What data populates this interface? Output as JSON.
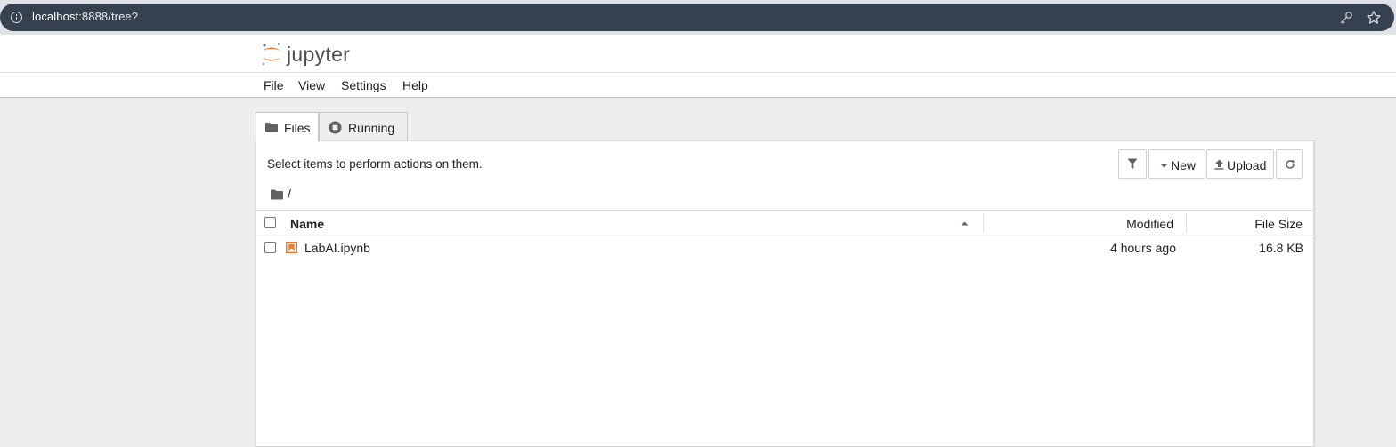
{
  "browser": {
    "url_host": "localhost",
    "url_rest": ":8888/tree?",
    "icons": [
      "info-icon",
      "key-icon",
      "star-icon"
    ]
  },
  "app": {
    "logo_text": "jupyter",
    "menu": [
      "File",
      "View",
      "Settings",
      "Help"
    ]
  },
  "tabs": [
    {
      "label": "Files",
      "icon": "folder-icon",
      "selected": true
    },
    {
      "label": "Running",
      "icon": "stop-circle-icon",
      "selected": false
    }
  ],
  "toolbar": {
    "instructions": "Select items to perform actions on them.",
    "new_label": "New",
    "upload_label": "Upload",
    "icons": [
      "filter-icon",
      "caret-down-icon",
      "upload-icon",
      "refresh-icon"
    ]
  },
  "breadcrumb": {
    "separator": "/"
  },
  "listing": {
    "columns": {
      "name": "Name",
      "modified": "Modified",
      "size": "File Size"
    },
    "sort": "name-ascending",
    "rows": [
      {
        "name": "LabAI.ipynb",
        "modified": "4 hours ago",
        "size": "16.8 KB",
        "icon": "notebook-icon"
      }
    ]
  },
  "colors": {
    "accent": "#f37726",
    "browser_bar": "#35414f",
    "background": "#eeeeee"
  }
}
